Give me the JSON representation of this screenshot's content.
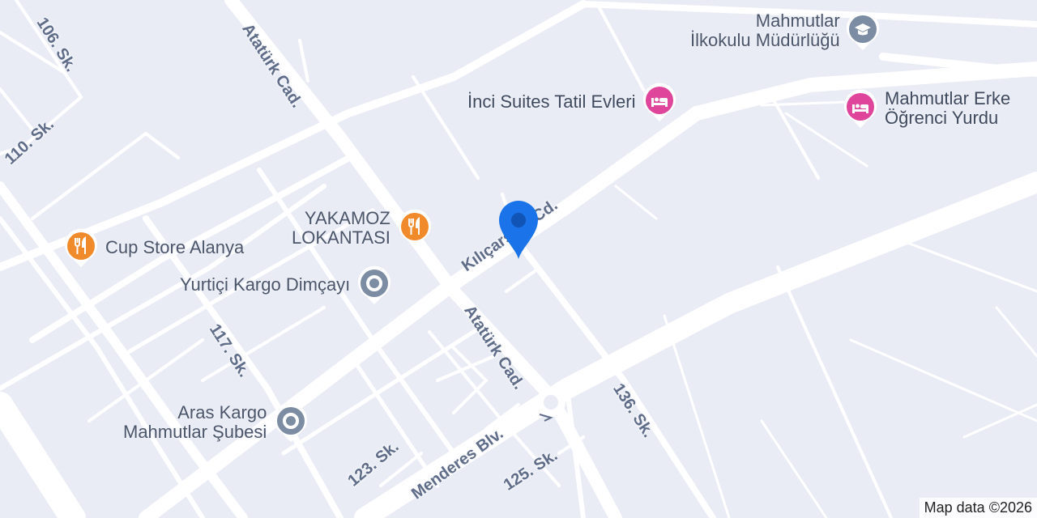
{
  "map": {
    "colors": {
      "background": "#e9ecf5",
      "road": "#ffffff",
      "restaurant": "#f08a2a",
      "lodging": "#e0459c",
      "school": "#7b8ca3",
      "generic_poi": "#7b8ca3",
      "pin": "#1a73e8"
    },
    "streets": {
      "s106": "106. Sk.",
      "s110": "110. Sk.",
      "ataturk_1": "Atatürk Cad.",
      "ataturk_2": "Atatürk Cad.",
      "kilicarslan": "Kılıçarslan Cd.",
      "s117": "117. Sk.",
      "s123": "123. Sk.",
      "menderes": "Menderes Blv.",
      "s125": "125. Sk.",
      "s136": "136. Sk."
    },
    "pois": {
      "school": {
        "line1": "Mahmutlar",
        "line2": "İlkokulu Müdürlüğü",
        "icon": "school-icon"
      },
      "inci": {
        "label": "İnci Suites Tatil Evleri",
        "icon": "bed-icon"
      },
      "yurdu": {
        "line1": "Mahmutlar Erke",
        "line2": "Öğrenci Yurdu",
        "icon": "bed-icon"
      },
      "yakamoz": {
        "line1": "YAKAMOZ",
        "line2": "LOKANTASI",
        "icon": "restaurant-icon"
      },
      "cupstore": {
        "label": "Cup Store Alanya",
        "icon": "restaurant-icon"
      },
      "yurtici": {
        "label": "Yurtiçi Kargo Dimçayı",
        "icon": "place-icon"
      },
      "aras": {
        "line1": "Aras Kargo",
        "line2": "Mahmutlar Şubesi",
        "icon": "place-icon"
      }
    },
    "attribution": "Map data ©2026"
  }
}
